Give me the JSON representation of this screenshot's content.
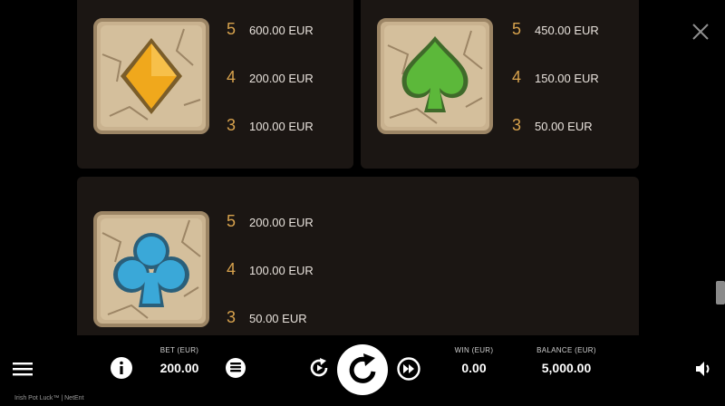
{
  "paytable": [
    {
      "symbol": "diamond",
      "color": "#f0a81c",
      "payouts": [
        {
          "count": "5",
          "value": "600.00 EUR"
        },
        {
          "count": "4",
          "value": "200.00 EUR"
        },
        {
          "count": "3",
          "value": "100.00 EUR"
        }
      ]
    },
    {
      "symbol": "spade",
      "color": "#5cb83a",
      "payouts": [
        {
          "count": "5",
          "value": "450.00 EUR"
        },
        {
          "count": "4",
          "value": "150.00 EUR"
        },
        {
          "count": "3",
          "value": "50.00 EUR"
        }
      ]
    },
    {
      "symbol": "club",
      "color": "#3aa8d8",
      "payouts": [
        {
          "count": "5",
          "value": "200.00 EUR"
        },
        {
          "count": "4",
          "value": "100.00 EUR"
        },
        {
          "count": "3",
          "value": "50.00 EUR"
        }
      ]
    }
  ],
  "bottom_bar": {
    "bet_label": "BET (EUR)",
    "bet_value": "200.00",
    "win_label": "WIN (EUR)",
    "win_value": "0.00",
    "balance_label": "BALANCE (EUR)",
    "balance_value": "5,000.00"
  },
  "footer": "Irish Pot Luck™ | NetEnt",
  "icons": [
    "menu-icon",
    "info-icon",
    "coin-stack-icon",
    "autoplay-icon",
    "spin-icon",
    "fast-forward-icon",
    "sound-icon",
    "close-icon"
  ]
}
